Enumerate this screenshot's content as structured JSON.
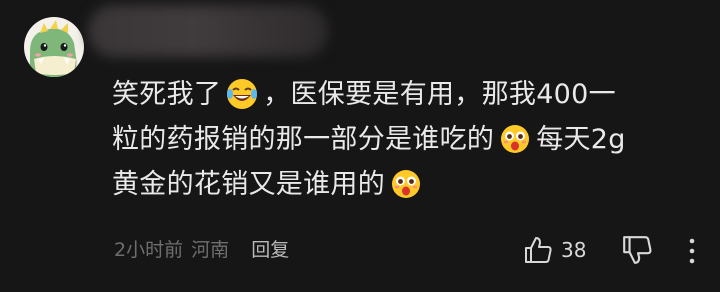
{
  "comment": {
    "username": "",
    "lines": [
      [
        "笑死我了",
        "，医保要是有用，那我400一"
      ],
      [
        "粒的药报销的那一部分是谁吃的",
        "每天2g"
      ],
      [
        "黄金的花销又是谁用的"
      ]
    ],
    "emojis": [
      "laughing-tears-emoji",
      "shocked-emoji",
      "shocked-emoji"
    ],
    "time": "2小时前",
    "location": "河南",
    "reply_label": "回复",
    "like_count": "38"
  },
  "colors": {
    "background": "#161616",
    "text": "#e9e9e9",
    "meta": "#6e6e6e",
    "emoji_yellow": "#ffca28"
  }
}
